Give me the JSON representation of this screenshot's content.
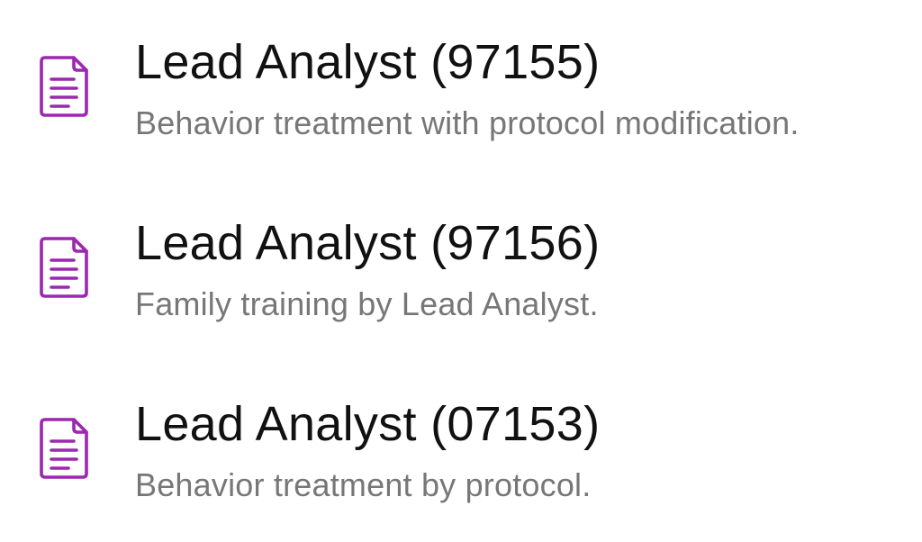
{
  "accent_color": "#9c27b0",
  "items": [
    {
      "icon": "document-icon",
      "title": "Lead Analyst (97155)",
      "subtitle": "Behavior treatment with protocol modification."
    },
    {
      "icon": "document-icon",
      "title": "Lead Analyst (97156)",
      "subtitle": "Family training by Lead Analyst."
    },
    {
      "icon": "document-icon",
      "title": "Lead Analyst (07153)",
      "subtitle": "Behavior treatment by protocol."
    }
  ]
}
